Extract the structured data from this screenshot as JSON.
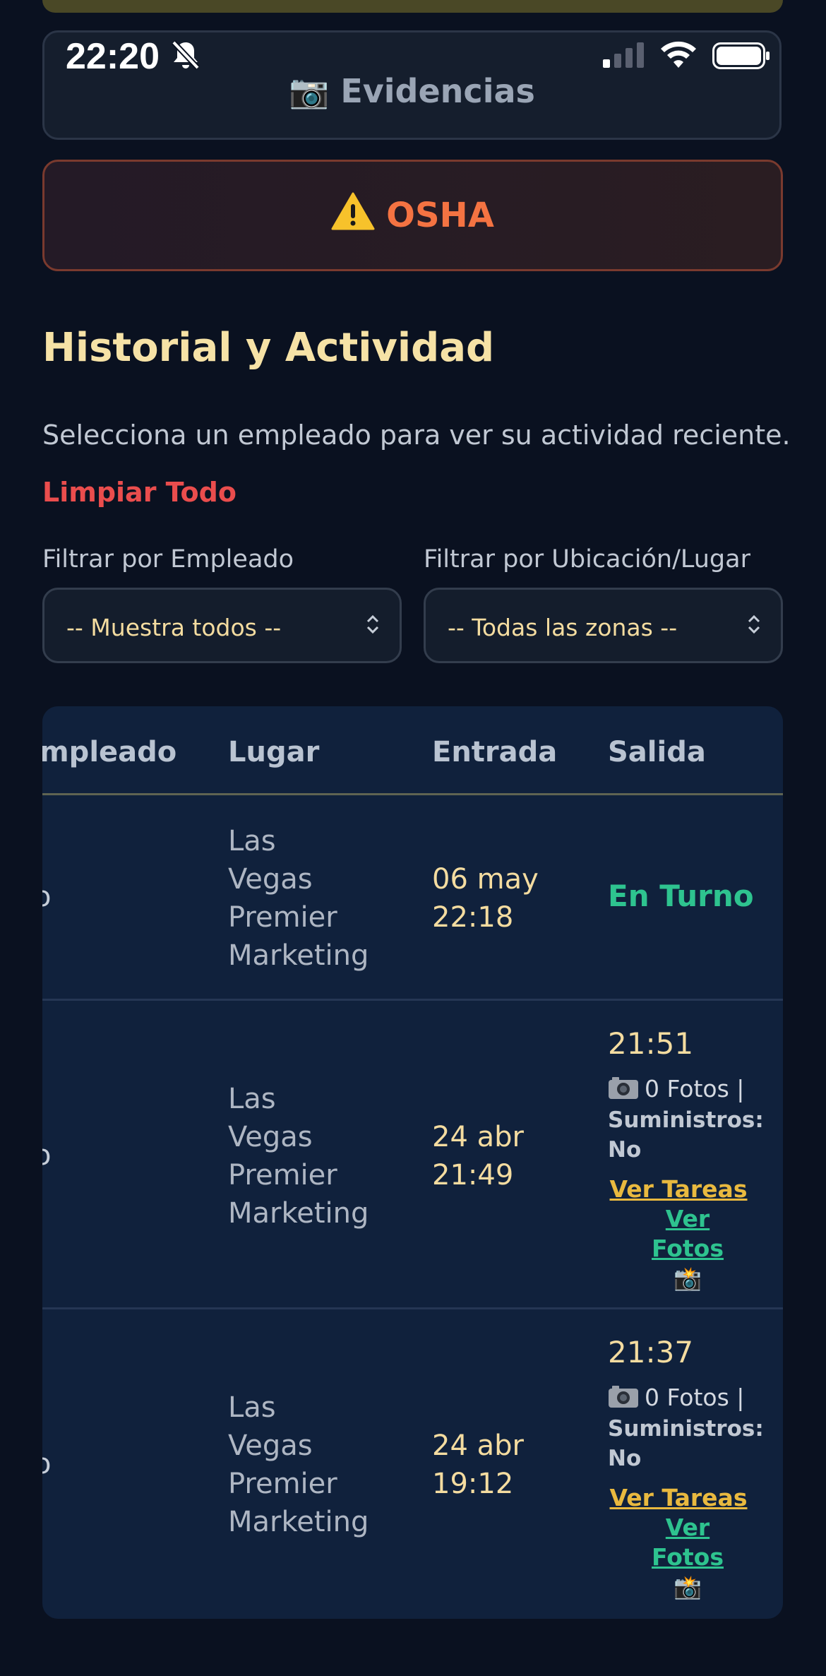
{
  "status_bar": {
    "time": "22:20"
  },
  "buttons": {
    "evidencias": "📷 Evidencias",
    "osha_icon": "⚠️",
    "osha": "OSHA"
  },
  "section": {
    "title": "Historial y Actividad",
    "description": "Selecciona un empleado para ver su actividad reciente.",
    "clear": "Limpiar Todo"
  },
  "filters": {
    "employee_label": "Filtrar por Empleado",
    "employee_value": "-- Muestra todos --",
    "location_label": "Filtrar por Ubicación/Lugar",
    "location_value": "-- Todas las zonas --"
  },
  "table": {
    "headers": {
      "empleado": "mpleado",
      "lugar": "Lugar",
      "entrada": "Entrada",
      "salida": "Salida"
    },
    "rows": [
      {
        "empleado": "o",
        "lugar": [
          "Las",
          "Vegas",
          "Premier",
          "Marketing"
        ],
        "entrada": [
          "06 may",
          "22:18"
        ],
        "salida": "En Turno"
      },
      {
        "empleado": "o",
        "lugar": [
          "Las",
          "Vegas",
          "Premier",
          "Marketing"
        ],
        "entrada": [
          "24 abr",
          "21:49"
        ],
        "salida_time": "21:51",
        "fotos": "0 Fotos |",
        "suministros_label": "Suministros:",
        "suministros_value": "No",
        "ver_tareas": "Ver Tareas",
        "ver_fotos": "Ver Fotos",
        "flash_icon": "📸"
      },
      {
        "empleado": "o",
        "lugar": [
          "Las",
          "Vegas",
          "Premier",
          "Marketing"
        ],
        "entrada": [
          "24 abr",
          "19:12"
        ],
        "salida_time": "21:37",
        "fotos": "0 Fotos |",
        "suministros_label": "Suministros:",
        "suministros_value": "No",
        "ver_tareas": "Ver Tareas",
        "ver_fotos": "Ver Fotos",
        "flash_icon": "📸"
      }
    ]
  },
  "icons": {
    "camera": "camera-icon",
    "warning": "warning-icon",
    "bell_off": "bell-off-icon",
    "signal": "cell-signal-icon",
    "wifi": "wifi-icon",
    "battery": "battery-icon",
    "chevron": "chevron-updown-icon"
  },
  "colors": {
    "background": "#0a1120",
    "title": "#f6e2a6",
    "osha": "#f47342",
    "clear": "#ea4d4d",
    "on_turn": "#2ec38f",
    "tareas_link": "#e9b93f"
  }
}
